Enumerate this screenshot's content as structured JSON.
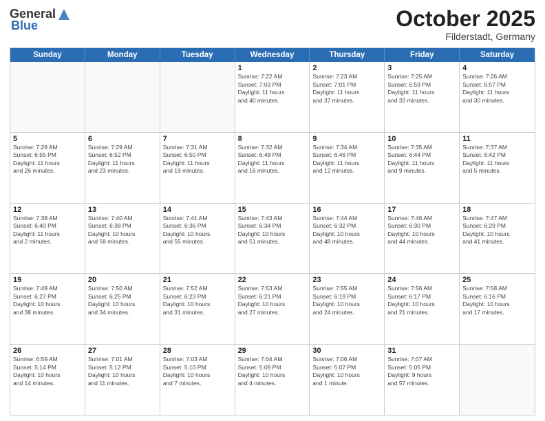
{
  "header": {
    "logo_general": "General",
    "logo_blue": "Blue",
    "month_title": "October 2025",
    "location": "Filderstadt, Germany"
  },
  "weekdays": [
    "Sunday",
    "Monday",
    "Tuesday",
    "Wednesday",
    "Thursday",
    "Friday",
    "Saturday"
  ],
  "rows": [
    [
      {
        "day": "",
        "text": ""
      },
      {
        "day": "",
        "text": ""
      },
      {
        "day": "",
        "text": ""
      },
      {
        "day": "1",
        "text": "Sunrise: 7:22 AM\nSunset: 7:03 PM\nDaylight: 11 hours\nand 40 minutes."
      },
      {
        "day": "2",
        "text": "Sunrise: 7:23 AM\nSunset: 7:01 PM\nDaylight: 11 hours\nand 37 minutes."
      },
      {
        "day": "3",
        "text": "Sunrise: 7:25 AM\nSunset: 6:59 PM\nDaylight: 11 hours\nand 33 minutes."
      },
      {
        "day": "4",
        "text": "Sunrise: 7:26 AM\nSunset: 6:57 PM\nDaylight: 11 hours\nand 30 minutes."
      }
    ],
    [
      {
        "day": "5",
        "text": "Sunrise: 7:28 AM\nSunset: 6:55 PM\nDaylight: 11 hours\nand 26 minutes."
      },
      {
        "day": "6",
        "text": "Sunrise: 7:29 AM\nSunset: 6:52 PM\nDaylight: 11 hours\nand 23 minutes."
      },
      {
        "day": "7",
        "text": "Sunrise: 7:31 AM\nSunset: 6:50 PM\nDaylight: 11 hours\nand 19 minutes."
      },
      {
        "day": "8",
        "text": "Sunrise: 7:32 AM\nSunset: 6:48 PM\nDaylight: 11 hours\nand 16 minutes."
      },
      {
        "day": "9",
        "text": "Sunrise: 7:34 AM\nSunset: 6:46 PM\nDaylight: 11 hours\nand 12 minutes."
      },
      {
        "day": "10",
        "text": "Sunrise: 7:35 AM\nSunset: 6:44 PM\nDaylight: 11 hours\nand 9 minutes."
      },
      {
        "day": "11",
        "text": "Sunrise: 7:37 AM\nSunset: 6:42 PM\nDaylight: 11 hours\nand 5 minutes."
      }
    ],
    [
      {
        "day": "12",
        "text": "Sunrise: 7:38 AM\nSunset: 6:40 PM\nDaylight: 11 hours\nand 2 minutes."
      },
      {
        "day": "13",
        "text": "Sunrise: 7:40 AM\nSunset: 6:38 PM\nDaylight: 10 hours\nand 58 minutes."
      },
      {
        "day": "14",
        "text": "Sunrise: 7:41 AM\nSunset: 6:36 PM\nDaylight: 10 hours\nand 55 minutes."
      },
      {
        "day": "15",
        "text": "Sunrise: 7:43 AM\nSunset: 6:34 PM\nDaylight: 10 hours\nand 51 minutes."
      },
      {
        "day": "16",
        "text": "Sunrise: 7:44 AM\nSunset: 6:32 PM\nDaylight: 10 hours\nand 48 minutes."
      },
      {
        "day": "17",
        "text": "Sunrise: 7:46 AM\nSunset: 6:30 PM\nDaylight: 10 hours\nand 44 minutes."
      },
      {
        "day": "18",
        "text": "Sunrise: 7:47 AM\nSunset: 6:29 PM\nDaylight: 10 hours\nand 41 minutes."
      }
    ],
    [
      {
        "day": "19",
        "text": "Sunrise: 7:49 AM\nSunset: 6:27 PM\nDaylight: 10 hours\nand 38 minutes."
      },
      {
        "day": "20",
        "text": "Sunrise: 7:50 AM\nSunset: 6:25 PM\nDaylight: 10 hours\nand 34 minutes."
      },
      {
        "day": "21",
        "text": "Sunrise: 7:52 AM\nSunset: 6:23 PM\nDaylight: 10 hours\nand 31 minutes."
      },
      {
        "day": "22",
        "text": "Sunrise: 7:53 AM\nSunset: 6:21 PM\nDaylight: 10 hours\nand 27 minutes."
      },
      {
        "day": "23",
        "text": "Sunrise: 7:55 AM\nSunset: 6:19 PM\nDaylight: 10 hours\nand 24 minutes."
      },
      {
        "day": "24",
        "text": "Sunrise: 7:56 AM\nSunset: 6:17 PM\nDaylight: 10 hours\nand 21 minutes."
      },
      {
        "day": "25",
        "text": "Sunrise: 7:58 AM\nSunset: 6:16 PM\nDaylight: 10 hours\nand 17 minutes."
      }
    ],
    [
      {
        "day": "26",
        "text": "Sunrise: 6:59 AM\nSunset: 5:14 PM\nDaylight: 10 hours\nand 14 minutes."
      },
      {
        "day": "27",
        "text": "Sunrise: 7:01 AM\nSunset: 5:12 PM\nDaylight: 10 hours\nand 11 minutes."
      },
      {
        "day": "28",
        "text": "Sunrise: 7:03 AM\nSunset: 5:10 PM\nDaylight: 10 hours\nand 7 minutes."
      },
      {
        "day": "29",
        "text": "Sunrise: 7:04 AM\nSunset: 5:09 PM\nDaylight: 10 hours\nand 4 minutes."
      },
      {
        "day": "30",
        "text": "Sunrise: 7:06 AM\nSunset: 5:07 PM\nDaylight: 10 hours\nand 1 minute."
      },
      {
        "day": "31",
        "text": "Sunrise: 7:07 AM\nSunset: 5:05 PM\nDaylight: 9 hours\nand 57 minutes."
      },
      {
        "day": "",
        "text": ""
      }
    ]
  ]
}
